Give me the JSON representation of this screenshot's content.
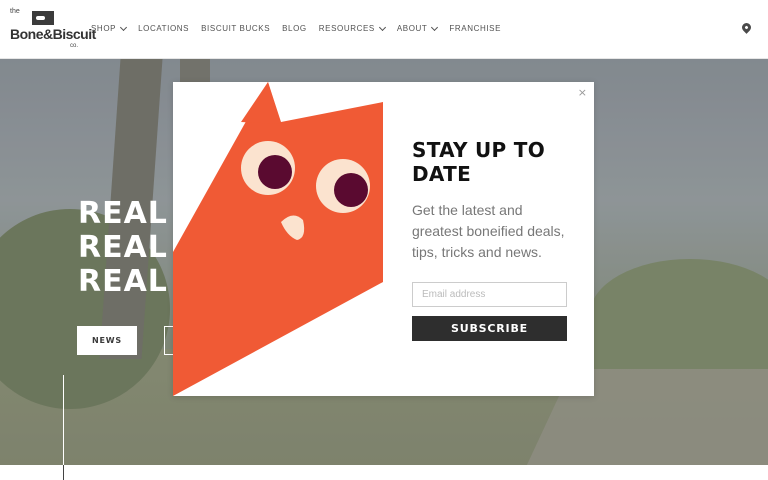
{
  "header": {
    "logo": {
      "small": "the",
      "word": "Bone&Biscuit",
      "co": "co."
    },
    "nav": [
      {
        "label": "SHOP",
        "dropdown": true
      },
      {
        "label": "LOCATIONS",
        "dropdown": false
      },
      {
        "label": "BISCUIT BUCKS",
        "dropdown": false
      },
      {
        "label": "BLOG",
        "dropdown": false
      },
      {
        "label": "RESOURCES",
        "dropdown": true
      },
      {
        "label": "ABOUT",
        "dropdown": true
      },
      {
        "label": "FRANCHISE",
        "dropdown": false
      }
    ],
    "location_icon": "map-pin-icon"
  },
  "hero": {
    "lines": [
      "REAL",
      "REAL",
      "REAL"
    ],
    "news_button": "NEWS"
  },
  "modal": {
    "close": "×",
    "title": "STAY UP TO DATE",
    "description": "Get the latest and greatest boneified deals, tips, tricks and news.",
    "email_placeholder": "Email address",
    "subscribe_label": "SUBSCRIBE",
    "colors": {
      "cat": "#f05a35",
      "eye_white": "#fbe3cf",
      "pupil": "#5a0a30",
      "button": "#2e2e2e"
    }
  }
}
